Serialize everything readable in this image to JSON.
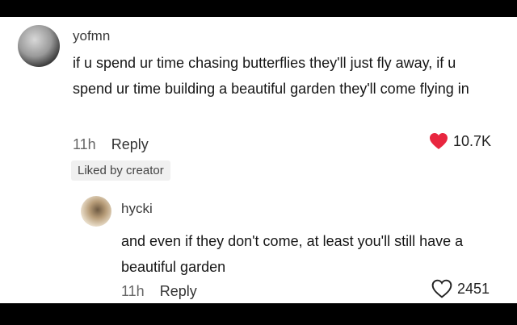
{
  "comment": {
    "username": "yofmn",
    "text": "if u spend ur time chasing butterflies they'll just fly away, if u spend ur time building a beautiful garden they'll come flying in",
    "time": "11h",
    "reply_label": "Reply",
    "likes": "10.7K",
    "liked_heart_color": "#e8263f",
    "liked_by_label": "Liked by creator",
    "reply": {
      "username": "hycki",
      "text": "and even if they don't come, at least you'll still have a beautiful garden",
      "time": "11h",
      "reply_label": "Reply",
      "likes": "2451"
    }
  }
}
